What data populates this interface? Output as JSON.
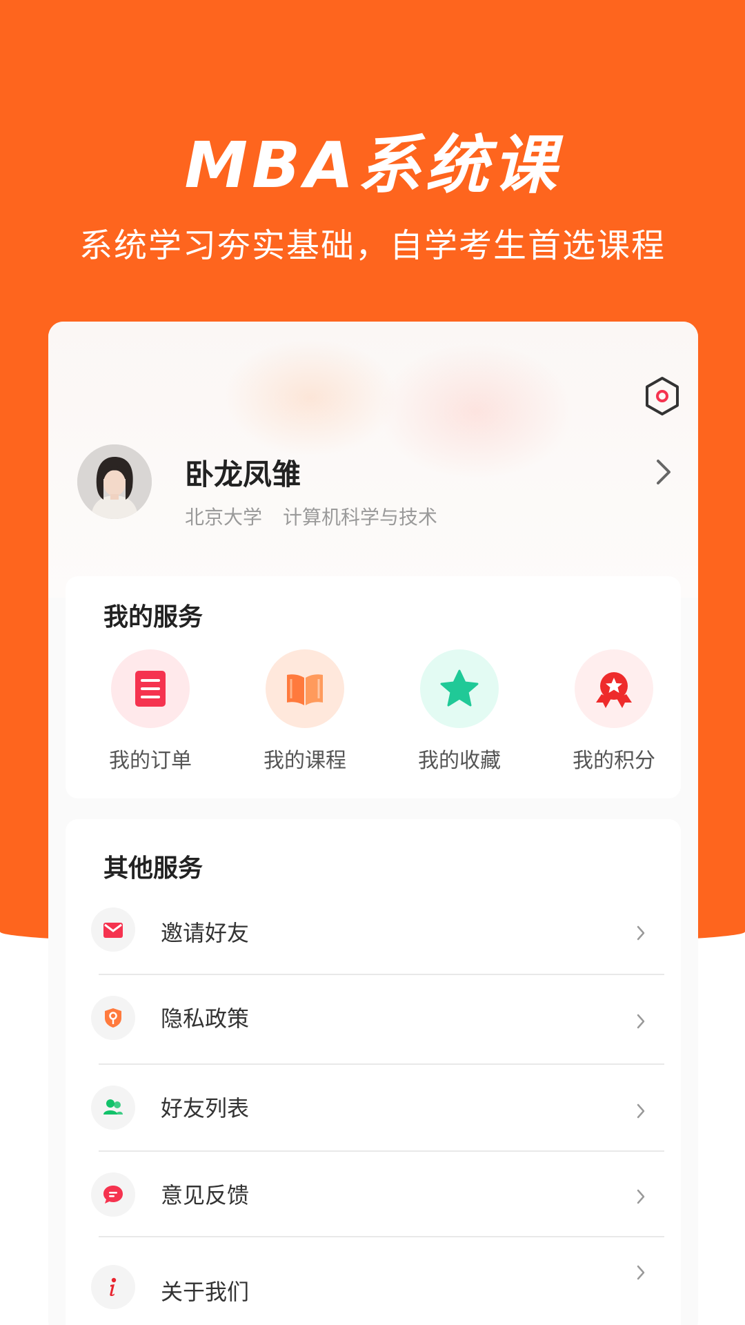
{
  "hero": {
    "title": "MBA系统课",
    "subtitle": "系统学习夯实基础，自学考生首选课程",
    "bg_color": "#fe651e"
  },
  "profile": {
    "name": "卧龙凤雏",
    "school": "北京大学",
    "major": "计算机科学与技术",
    "settings_icon": "settings-hexagon-icon",
    "arrow_icon": "chevron-right-icon"
  },
  "my_services": {
    "title": "我的服务",
    "items": [
      {
        "label": "我的订单",
        "icon": "order-list-icon",
        "bg": "#ffe9eb",
        "color": "#f5334f"
      },
      {
        "label": "我的课程",
        "icon": "open-book-icon",
        "bg": "#ffe8dc",
        "color": "#ff7a3d"
      },
      {
        "label": "我的收藏",
        "icon": "star-icon",
        "bg": "#e3fbf3",
        "color": "#20c997"
      },
      {
        "label": "我的积分",
        "icon": "award-medal-icon",
        "bg": "#ffeeee",
        "color": "#ee2b2b"
      }
    ]
  },
  "other_services": {
    "title": "其他服务",
    "items": [
      {
        "label": "邀请好友",
        "icon": "envelope-icon",
        "color": "#f5334f"
      },
      {
        "label": "隐私政策",
        "icon": "shield-key-icon",
        "color": "#ff7a3d"
      },
      {
        "label": "好友列表",
        "icon": "friends-icon",
        "color": "#12c26a"
      },
      {
        "label": "意见反馈",
        "icon": "feedback-chat-icon",
        "color": "#f5334f"
      },
      {
        "label": "关于我们",
        "icon": "info-icon",
        "color": "#e8242f"
      }
    ]
  }
}
